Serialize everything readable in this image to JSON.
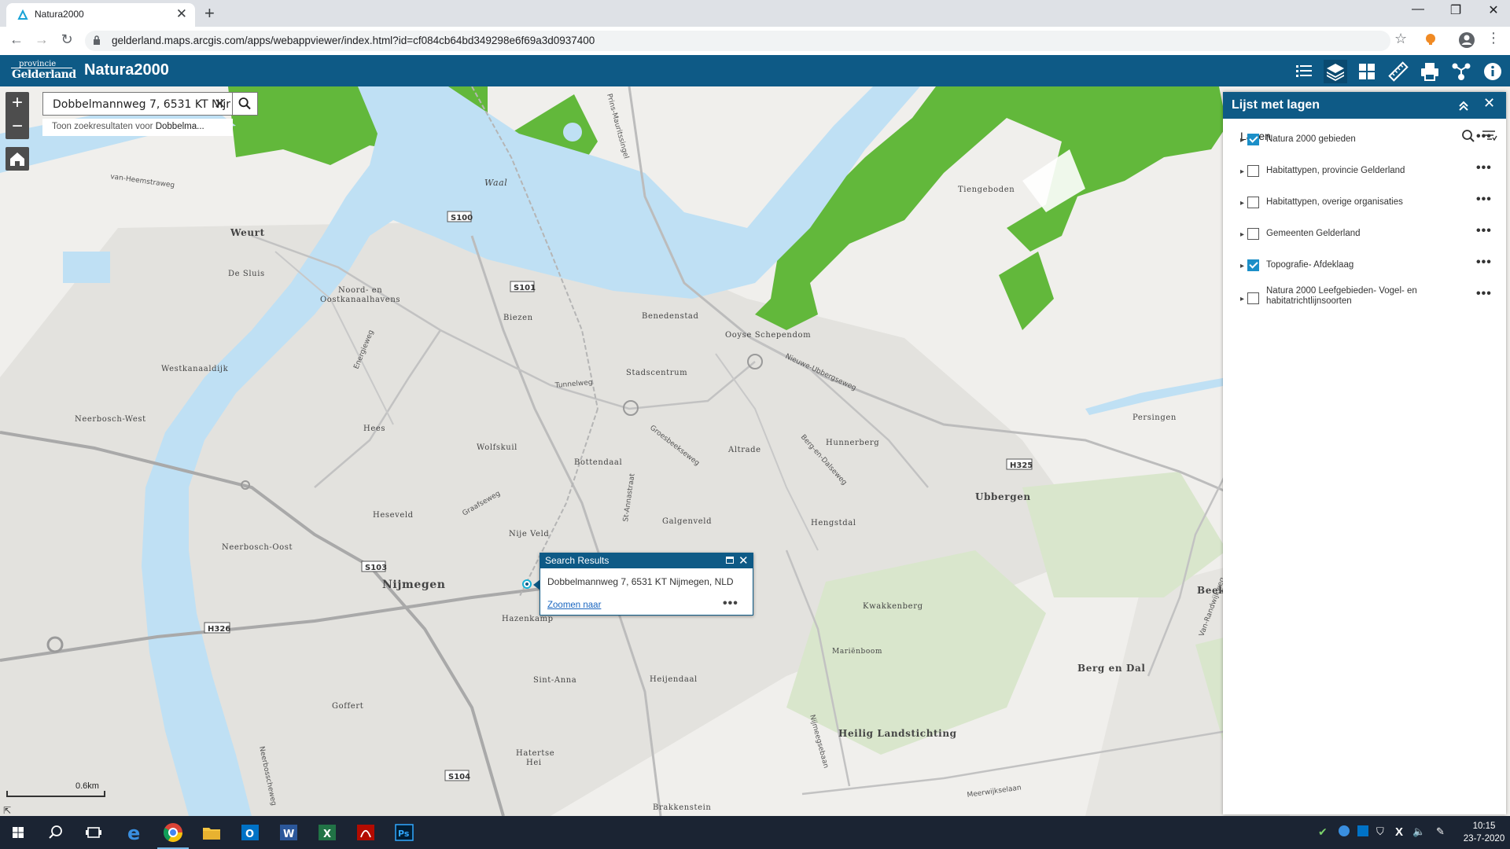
{
  "browser": {
    "tab_title": "Natura2000",
    "tab_close": "✕",
    "new_tab": "+",
    "url": "gelderland.maps.arcgis.com/apps/webappviewer/index.html?id=cf084cb64bd349298e6f69a3d0937400",
    "window_minimize": "—",
    "window_restore": "❐",
    "window_close": "✕"
  },
  "app": {
    "logo_line1": "provincie",
    "logo_line2": "Gelderland",
    "title": "Natura2000",
    "header_icons": [
      "list-icon",
      "layers-icon",
      "basemap-gallery-icon",
      "measure-icon",
      "print-icon",
      "share-icon",
      "info-icon"
    ]
  },
  "search": {
    "value": "Dobbelmannweg 7, 6531 KT Nijr",
    "clear": "✕",
    "suggestion_prefix": "Toon zoekresultaten voor ",
    "suggestion_term": "Dobbelma..."
  },
  "zoom": {
    "in": "+",
    "out": "−"
  },
  "popup": {
    "title": "Search Results",
    "close": "✕",
    "address": "Dobbelmannweg 7, 6531 KT Nijmegen, NLD",
    "link": "Zoomen naar",
    "more": "•••"
  },
  "scale": {
    "label": "0.6km"
  },
  "layer_panel": {
    "title": "Lijst met lagen",
    "collapse": "⌃",
    "close": "✕",
    "subtitle": "Lagen",
    "layers": [
      {
        "label": "Natura 2000 gebieden",
        "checked": true
      },
      {
        "label": "Habitattypen, provincie Gelderland",
        "checked": false
      },
      {
        "label": "Habitattypen, overige organisaties",
        "checked": false
      },
      {
        "label": "Gemeenten Gelderland",
        "checked": false
      },
      {
        "label": "Topografie- Afdeklaag",
        "checked": true
      },
      {
        "label": "Natura 2000 Leefgebieden- Vogel- en habitatrichtlijnsoorten",
        "checked": false
      }
    ],
    "expand_arrow": "▸",
    "more": "•••"
  },
  "map_labels": [
    "Weurt",
    "De Sluis",
    "Noord- en",
    "Oostkanaalhavens",
    "Westkanaaldijk",
    "Neerbosch-West",
    "Hees",
    "Wolfskuil",
    "Biezen",
    "Benedenstad",
    "Stadscentrum",
    "Ooyse Schependom",
    "Tiengeboden",
    "Bottendaal",
    "Altrade",
    "Hunnerberg",
    "Persingen",
    "Ubbergen",
    "Heseveld",
    "Nije Veld",
    "Galgenveld",
    "Hengstdal",
    "Neerbosch-Oost",
    "Nijmegen",
    "Hazenkamp",
    "Kwakkenberg",
    "Mariënboom",
    "Berg en Dal",
    "Sint-Anna",
    "Heijendaal",
    "Goffert",
    "Heilig Landstichting",
    "Hatertse Hei",
    "Brakkenstein",
    "Beek",
    "Waal"
  ],
  "road_labels": [
    "S100",
    "S101",
    "S103",
    "H326",
    "H325",
    "S104"
  ],
  "street_labels": [
    "van-Heemstraweg",
    "Energieweg",
    "Tunnelweg",
    "Graafseweg",
    "Groesbeekseweg",
    "St-Annastraat",
    "Nieuwe-Ubbergseweg",
    "Berg-en-Dalseweg",
    "Nijmeegsebaan",
    "Meerwijkselaan",
    "Van-Randwijkweg",
    "Neerbosscheweg",
    "Prins-Mauritssingel"
  ],
  "taskbar": {
    "time": "10:15",
    "date": "23-7-2020",
    "apps": [
      "start-icon",
      "search-icon",
      "task-view-icon",
      "edge-icon",
      "chrome-icon",
      "file-explorer-icon",
      "outlook-icon",
      "word-icon",
      "excel-icon",
      "acrobat-icon",
      "photoshop-icon"
    ]
  },
  "colors": {
    "header": "#0e5a86",
    "natura_green": "#62b83b",
    "water": "#bfe0f4",
    "map_bg": "#f0efec",
    "checkbox": "#1c8fc8"
  }
}
